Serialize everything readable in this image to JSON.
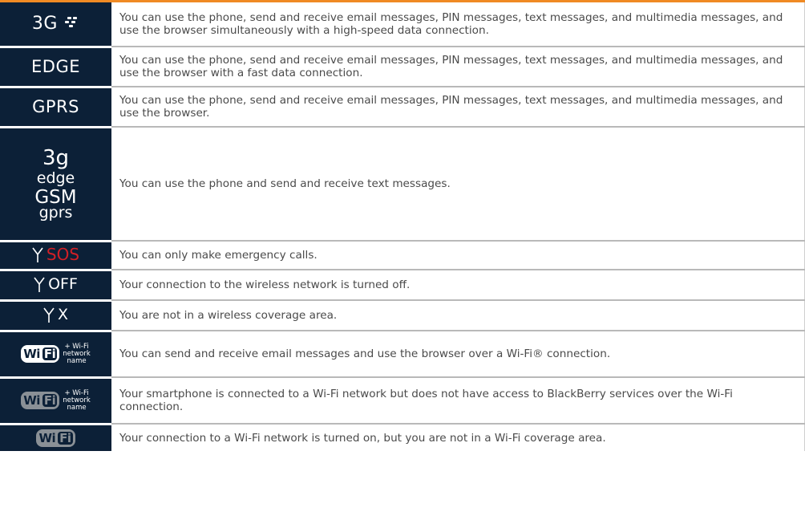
{
  "accent": "#f08a24",
  "icon_cell_bg": "#0c2037",
  "sos_color": "#d11f26",
  "rows": [
    {
      "label": "3G",
      "icon": "blackberry-logo-icon",
      "text": "You can use the phone, send and receive email messages, PIN messages, text messages, and multimedia messages, and use the browser simultaneously with a high-speed data connection."
    },
    {
      "label": "EDGE",
      "text": "You can use the phone, send and receive email messages, PIN messages, text messages, and multimedia messages, and use the browser with a fast data connection."
    },
    {
      "label": "GPRS",
      "text": "You can use the phone, send and receive email messages, PIN messages, text messages, and multimedia messages, and use the browser."
    },
    {
      "labels": [
        "3g",
        "edge",
        "GSM",
        "gprs"
      ],
      "text": "You can use the phone and send and receive text messages."
    },
    {
      "label": "SOS",
      "icon": "antenna-icon",
      "text": "You can only make emergency calls."
    },
    {
      "label": "OFF",
      "icon": "antenna-icon",
      "text": "Your connection to the wireless network is turned off."
    },
    {
      "label": "X",
      "icon": "antenna-icon",
      "text": "You are not in a wireless coverage area."
    },
    {
      "badge": [
        "Wi",
        "Fi"
      ],
      "sub": [
        "+ Wi-Fi",
        "network",
        "name"
      ],
      "icon": "wifi-logo-icon",
      "text": "You can send and receive email messages and use the browser over a Wi-Fi® connection."
    },
    {
      "badge": [
        "Wi",
        "Fi"
      ],
      "sub": [
        "+ Wi-Fi",
        "network",
        "name"
      ],
      "icon": "wifi-logo-dimmed-icon",
      "text": "Your smartphone is connected to a Wi-Fi network but does not have access to BlackBerry services over the Wi-Fi connection."
    },
    {
      "badge": [
        "Wi",
        "Fi"
      ],
      "icon": "wifi-logo-dimmed-icon",
      "text": "Your connection to a Wi-Fi network is turned on, but you are not in a Wi-Fi coverage area."
    }
  ]
}
